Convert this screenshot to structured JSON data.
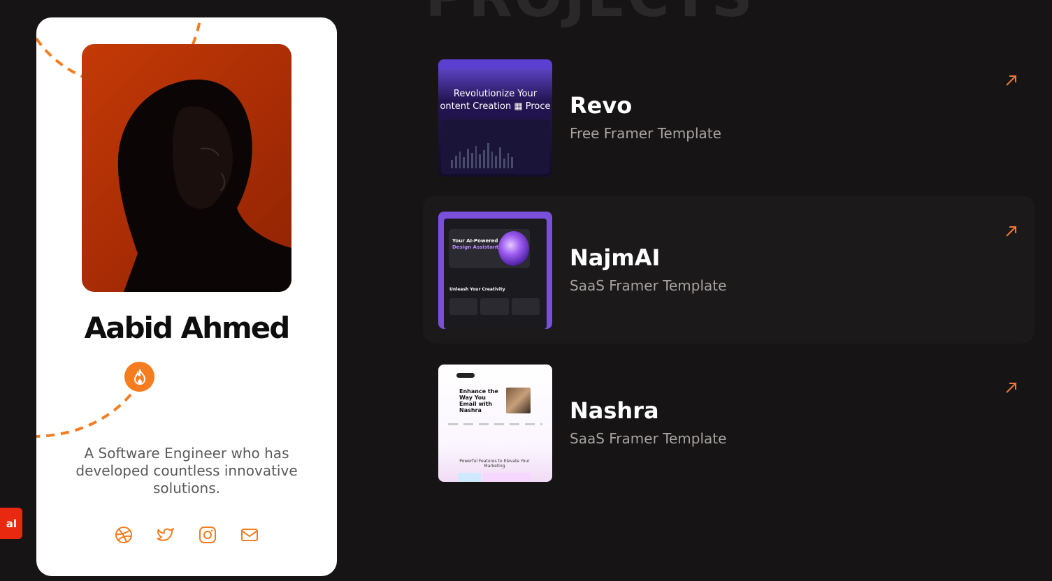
{
  "page": {
    "section_heading": "PROJECTS"
  },
  "profile": {
    "name": "Aabid Ahmed",
    "bio": "A Software Engineer who has developed countless innovative solutions.",
    "badge_icon": "flame-icon",
    "accent_color": "#f57c1f",
    "socials": [
      {
        "name": "dribbble",
        "icon": "dribbble-icon"
      },
      {
        "name": "twitter",
        "icon": "twitter-icon"
      },
      {
        "name": "instagram",
        "icon": "instagram-icon"
      },
      {
        "name": "email",
        "icon": "mail-icon"
      }
    ]
  },
  "side_tab": {
    "label": "al",
    "color": "#e8290f"
  },
  "projects": [
    {
      "title": "Revo",
      "subtitle": "Free Framer Template",
      "thumb_text_1": "Revolutionize Your",
      "thumb_text_2": "ontent Creation ▦ Proce",
      "arrow_icon": "arrow-up-right-icon"
    },
    {
      "title": "NajmAI",
      "subtitle": "SaaS Framer Template",
      "thumb_text_1": "Your AI-Powered",
      "thumb_text_2": "Design Assistant",
      "thumb_text_3": "Unleash Your Creativity",
      "arrow_icon": "arrow-up-right-icon"
    },
    {
      "title": "Nashra",
      "subtitle": "SaaS Framer Template",
      "thumb_text_1": "Enhance the Way You Email with Nashra",
      "thumb_text_2": "Powerful Features to Elevate Your Marketing",
      "arrow_icon": "arrow-up-right-icon"
    }
  ]
}
